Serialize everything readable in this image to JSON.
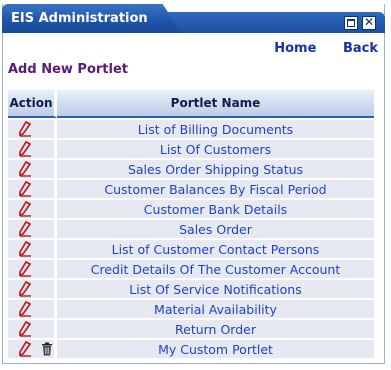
{
  "window": {
    "title": "EIS Administration",
    "restore_icon": "restore-window-icon",
    "close_icon": "close-window-icon"
  },
  "nav": {
    "home_label": "Home",
    "back_label": "Back"
  },
  "add_portlet_label": "Add New Portlet",
  "table": {
    "headers": [
      "Action",
      "Portlet Name"
    ],
    "rows": [
      {
        "name": "List of Billing Documents",
        "actions": [
          "edit-icon"
        ]
      },
      {
        "name": "List Of Customers",
        "actions": [
          "edit-icon"
        ]
      },
      {
        "name": "Sales Order Shipping Status",
        "actions": [
          "edit-icon"
        ]
      },
      {
        "name": "Customer Balances By Fiscal Period",
        "actions": [
          "edit-icon"
        ]
      },
      {
        "name": "Customer Bank Details",
        "actions": [
          "edit-icon"
        ]
      },
      {
        "name": "Sales Order",
        "actions": [
          "edit-icon"
        ]
      },
      {
        "name": "List of Customer Contact Persons",
        "actions": [
          "edit-icon"
        ]
      },
      {
        "name": "Credit Details Of The Customer Account",
        "actions": [
          "edit-icon"
        ]
      },
      {
        "name": "List Of Service Notifications",
        "actions": [
          "edit-icon"
        ]
      },
      {
        "name": "Material Availability",
        "actions": [
          "edit-icon"
        ]
      },
      {
        "name": "Return Order",
        "actions": [
          "edit-icon"
        ]
      },
      {
        "name": "My Custom Portlet",
        "actions": [
          "edit-icon",
          "trash-icon"
        ]
      }
    ]
  },
  "colors": {
    "title_bar": "#1e54a8",
    "link": "#2244c0",
    "add_link": "#5a1a7a",
    "row_bg": "#e6e8f2",
    "edit_icon_red": "#c0141a"
  }
}
